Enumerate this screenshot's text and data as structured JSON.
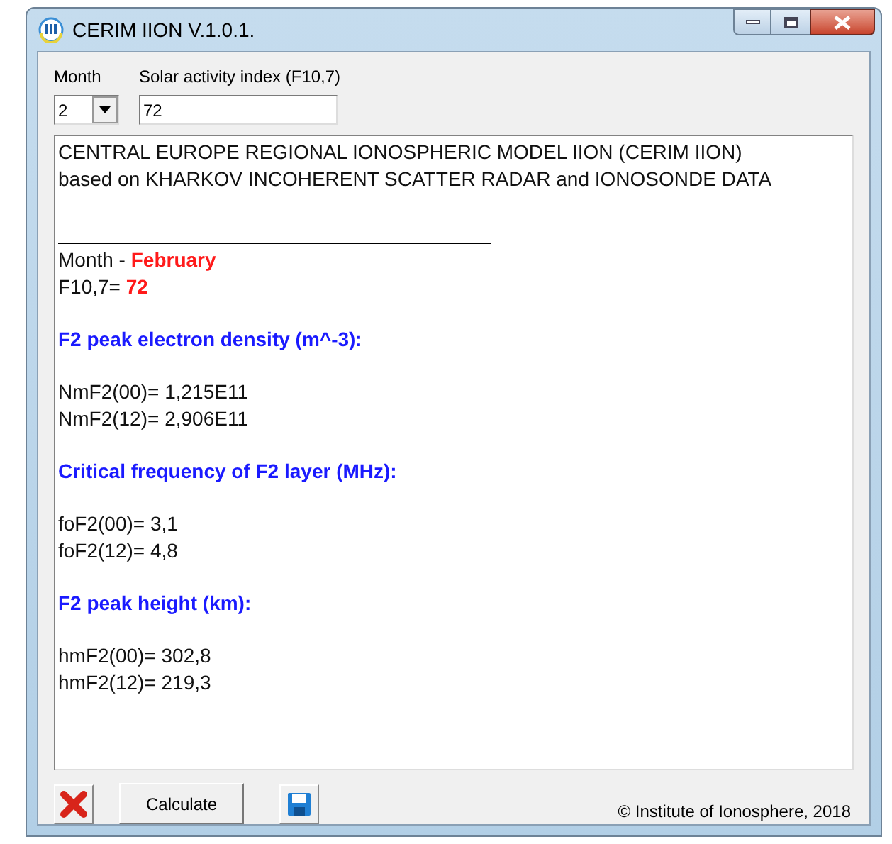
{
  "window": {
    "title": "CERIM IION V.1.0.1."
  },
  "month_field": {
    "label": "Month",
    "value": "2"
  },
  "solar_field": {
    "label": "Solar activity index (F10,7)",
    "value": "72"
  },
  "report": {
    "intro": [
      "CENTRAL EUROPE REGIONAL IONOSPHERIC MODEL IION (CERIM IION)",
      "based on KHARKOV INCOHERENT SCATTER RADAR and IONOSONDE DATA"
    ],
    "params": [
      {
        "label": "Month - ",
        "value": "February"
      },
      {
        "label": "F10,7= ",
        "value": "72"
      }
    ],
    "sections": [
      {
        "heading": "F2 peak electron density (m^-3):",
        "lines": [
          "NmF2(00)= 1,215E11",
          "NmF2(12)= 2,906E11"
        ]
      },
      {
        "heading": "Critical frequency of F2 layer (MHz):",
        "lines": [
          "foF2(00)= 3,1",
          "foF2(12)= 4,8"
        ]
      },
      {
        "heading": "F2 peak height (km):",
        "lines": [
          "hmF2(00)= 302,8",
          "hmF2(12)= 219,3"
        ]
      }
    ]
  },
  "buttons": {
    "calculate": "Calculate"
  },
  "footer": "© Institute of Ionosphere, 2018"
}
